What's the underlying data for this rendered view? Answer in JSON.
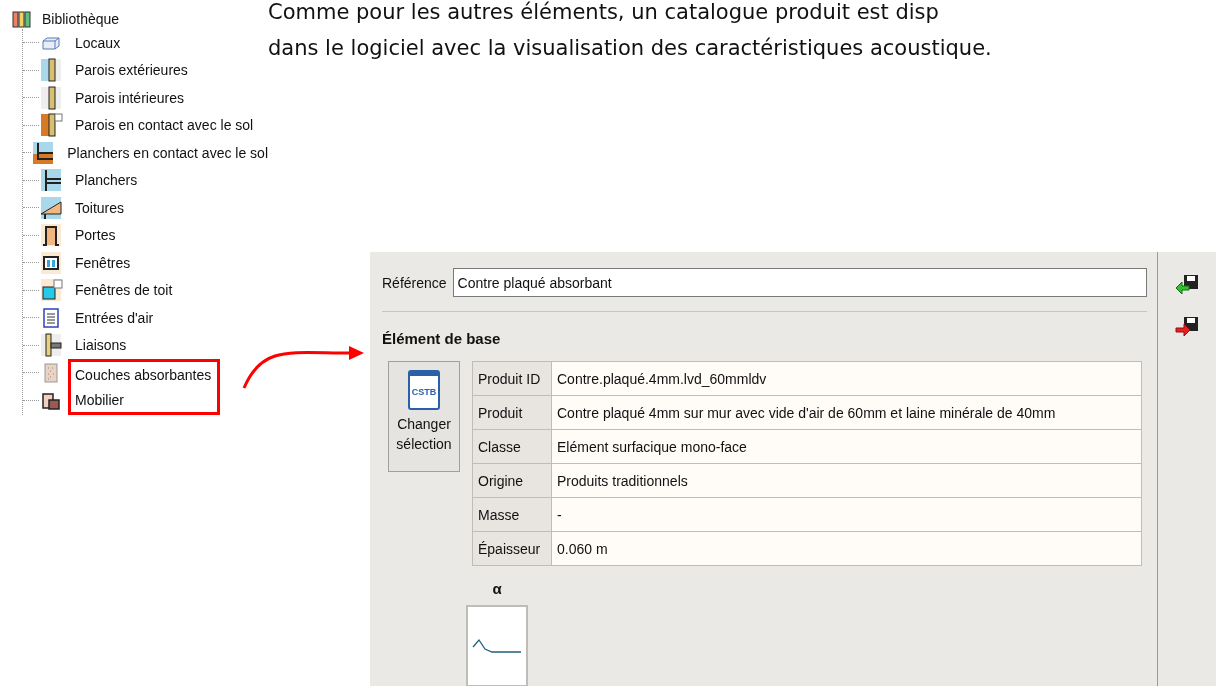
{
  "tree": {
    "label": "Bibliothèque",
    "children": [
      {
        "label": "Locaux",
        "kind": "rooms",
        "highlighted": false
      },
      {
        "label": "Parois extérieures",
        "kind": "wall-ext",
        "highlighted": false
      },
      {
        "label": "Parois intérieures",
        "kind": "wall-int",
        "highlighted": false
      },
      {
        "label": "Parois en contact avec le sol",
        "kind": "wall-ground",
        "highlighted": false
      },
      {
        "label": "Planchers en contact avec le sol",
        "kind": "floor-ground",
        "highlighted": false
      },
      {
        "label": "Planchers",
        "kind": "floor",
        "highlighted": false
      },
      {
        "label": "Toitures",
        "kind": "roof",
        "highlighted": false
      },
      {
        "label": "Portes",
        "kind": "door",
        "highlighted": false
      },
      {
        "label": "Fenêtres",
        "kind": "window",
        "highlighted": false
      },
      {
        "label": "Fenêtres de toit",
        "kind": "roof-window",
        "highlighted": false
      },
      {
        "label": "Entrées d'air",
        "kind": "air-inlet",
        "highlighted": false
      },
      {
        "label": "Liaisons",
        "kind": "junction",
        "highlighted": false
      },
      {
        "label": "Couches absorbantes",
        "kind": "absorbent",
        "highlighted": true
      },
      {
        "label": "Mobilier",
        "kind": "furniture",
        "highlighted": true
      }
    ]
  },
  "paragraph": [
    "Comme pour les autres éléments, un catalogue produit est disp",
    "dans le logiciel avec la visualisation des caractéristiques acoustique."
  ],
  "panel": {
    "reference_label": "Référence",
    "reference_value": "Contre plaqué absorbant",
    "section_title": "Élément de base",
    "change_button": {
      "logo": "CSTB",
      "label": "Changer sélection"
    },
    "properties": [
      {
        "label": "Produit ID",
        "value": "Contre.plaqué.4mm.lvd_60mmldv"
      },
      {
        "label": "Produit",
        "value": "Contre plaqué 4mm sur mur avec vide d'air de 60mm et laine minérale de 40mm"
      },
      {
        "label": "Classe",
        "value": "Elément surfacique mono-face"
      },
      {
        "label": "Origine",
        "value": "Produits traditionnels"
      },
      {
        "label": "Masse",
        "value": "-"
      },
      {
        "label": "Épaisseur",
        "value": "0.060 m"
      }
    ],
    "curve_label": "α",
    "side_buttons": [
      {
        "kind": "import"
      },
      {
        "kind": "export"
      }
    ]
  }
}
